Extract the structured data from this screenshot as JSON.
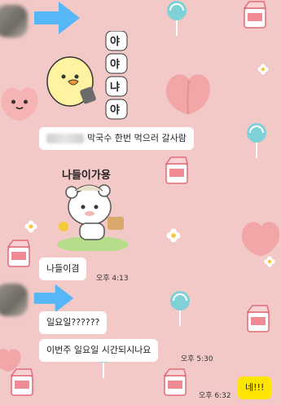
{
  "colors": {
    "background": "#f3c9c7",
    "my_bubble": "#fee500",
    "bubble": "#ffffff"
  },
  "messages": [
    {
      "sender": "other",
      "text": "막국수 한번 먹으러 갈사람"
    },
    {
      "sender": "other",
      "type": "sticker",
      "sticker_text": "나들이가용"
    },
    {
      "sender": "other",
      "text": "나들이겸",
      "time": "오후 4:13"
    },
    {
      "sender": "other",
      "text": "일요일??????"
    },
    {
      "sender": "other",
      "text": "이번주 일요일 시간되시나요",
      "time": "오후 5:30"
    },
    {
      "sender": "me",
      "text": "네!!!",
      "time": "오후 6:32"
    }
  ],
  "stickers": {
    "duck_labels": [
      "야",
      "야",
      "냐",
      "야"
    ]
  },
  "icons": [
    "avatar",
    "arrow-icon",
    "duck-sticker",
    "bear-sticker",
    "peach-icon",
    "milk-carton-icon",
    "lollipop-icon",
    "flower-icon"
  ]
}
